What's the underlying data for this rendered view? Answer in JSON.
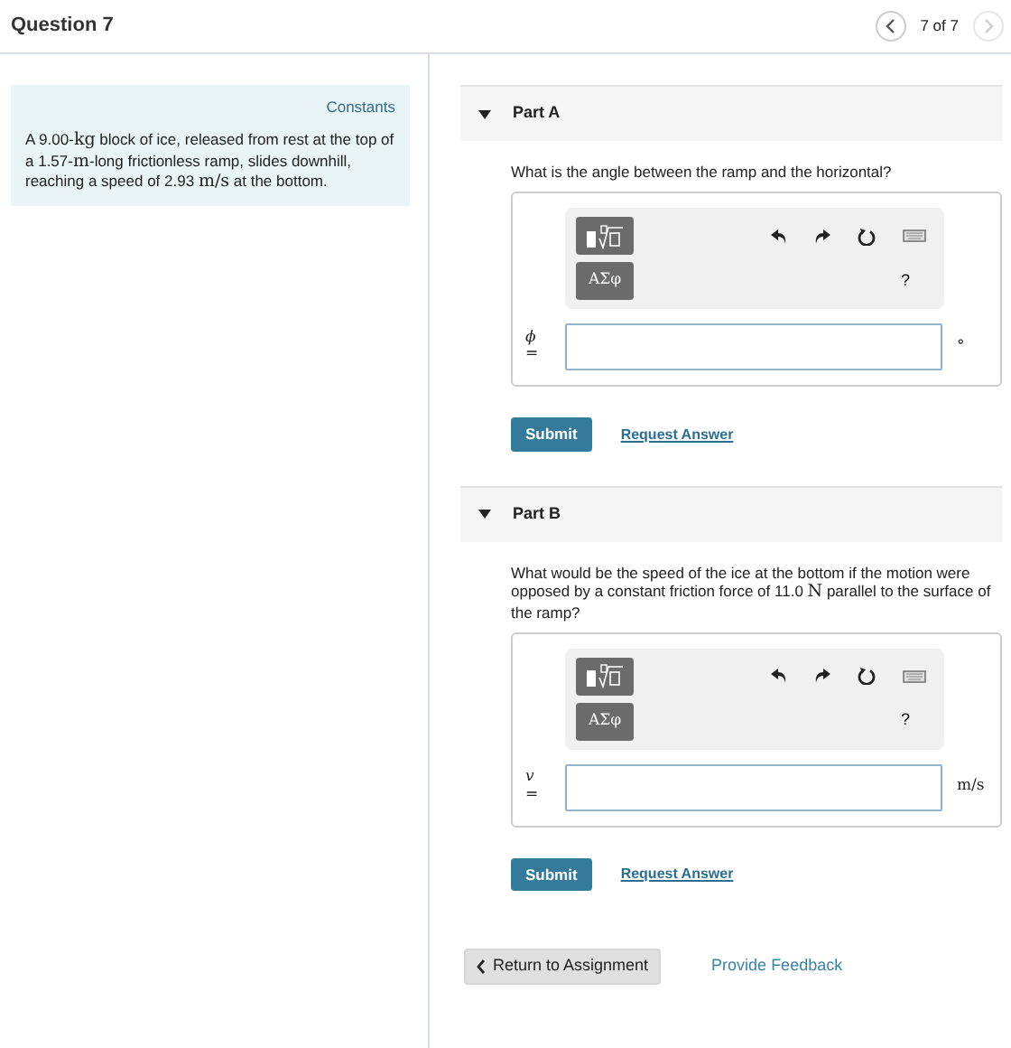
{
  "header": {
    "title": "Question 7",
    "pager": "7 of 7",
    "prev_disabled": false,
    "next_disabled": true
  },
  "constants_panel": {
    "title": "Constants",
    "problem": [
      {
        "kind": "text",
        "text": "A 9.00-"
      },
      {
        "kind": "unit",
        "text": "kg"
      },
      {
        "kind": "text",
        "text": " block of ice, released from rest at the top of a 1.57-"
      },
      {
        "kind": "unit",
        "text": "m"
      },
      {
        "kind": "text",
        "text": "-long frictionless ramp, slides downhill, reaching a speed of 2.93 "
      },
      {
        "kind": "unit",
        "text": "m/s"
      },
      {
        "kind": "text",
        "text": " at the bottom."
      }
    ]
  },
  "parts": [
    {
      "title": "Part A",
      "expanded": true,
      "question": [
        {
          "kind": "text",
          "text": "What is the angle between the ramp and the horizontal?"
        }
      ],
      "symbols": "ΑΣφ",
      "help": "?",
      "variable": "ϕ",
      "equals": "=",
      "unit": "°",
      "submit": "Submit",
      "request": "Request Answer"
    },
    {
      "title": "Part B",
      "expanded": true,
      "question": [
        {
          "kind": "text",
          "text": "What would be the speed of the ice at the bottom if the motion were opposed by a constant friction force of 11.0 "
        },
        {
          "kind": "unit",
          "text": "N"
        },
        {
          "kind": "text",
          "text": " parallel to the surface of the ramp?"
        }
      ],
      "symbols": "ΑΣφ",
      "help": "?",
      "variable": "v",
      "equals": "=",
      "unit": "m/s",
      "submit": "Submit",
      "request": "Request Answer"
    }
  ],
  "footer": {
    "return": "Return to Assignment",
    "feedback": "Provide Feedback"
  }
}
